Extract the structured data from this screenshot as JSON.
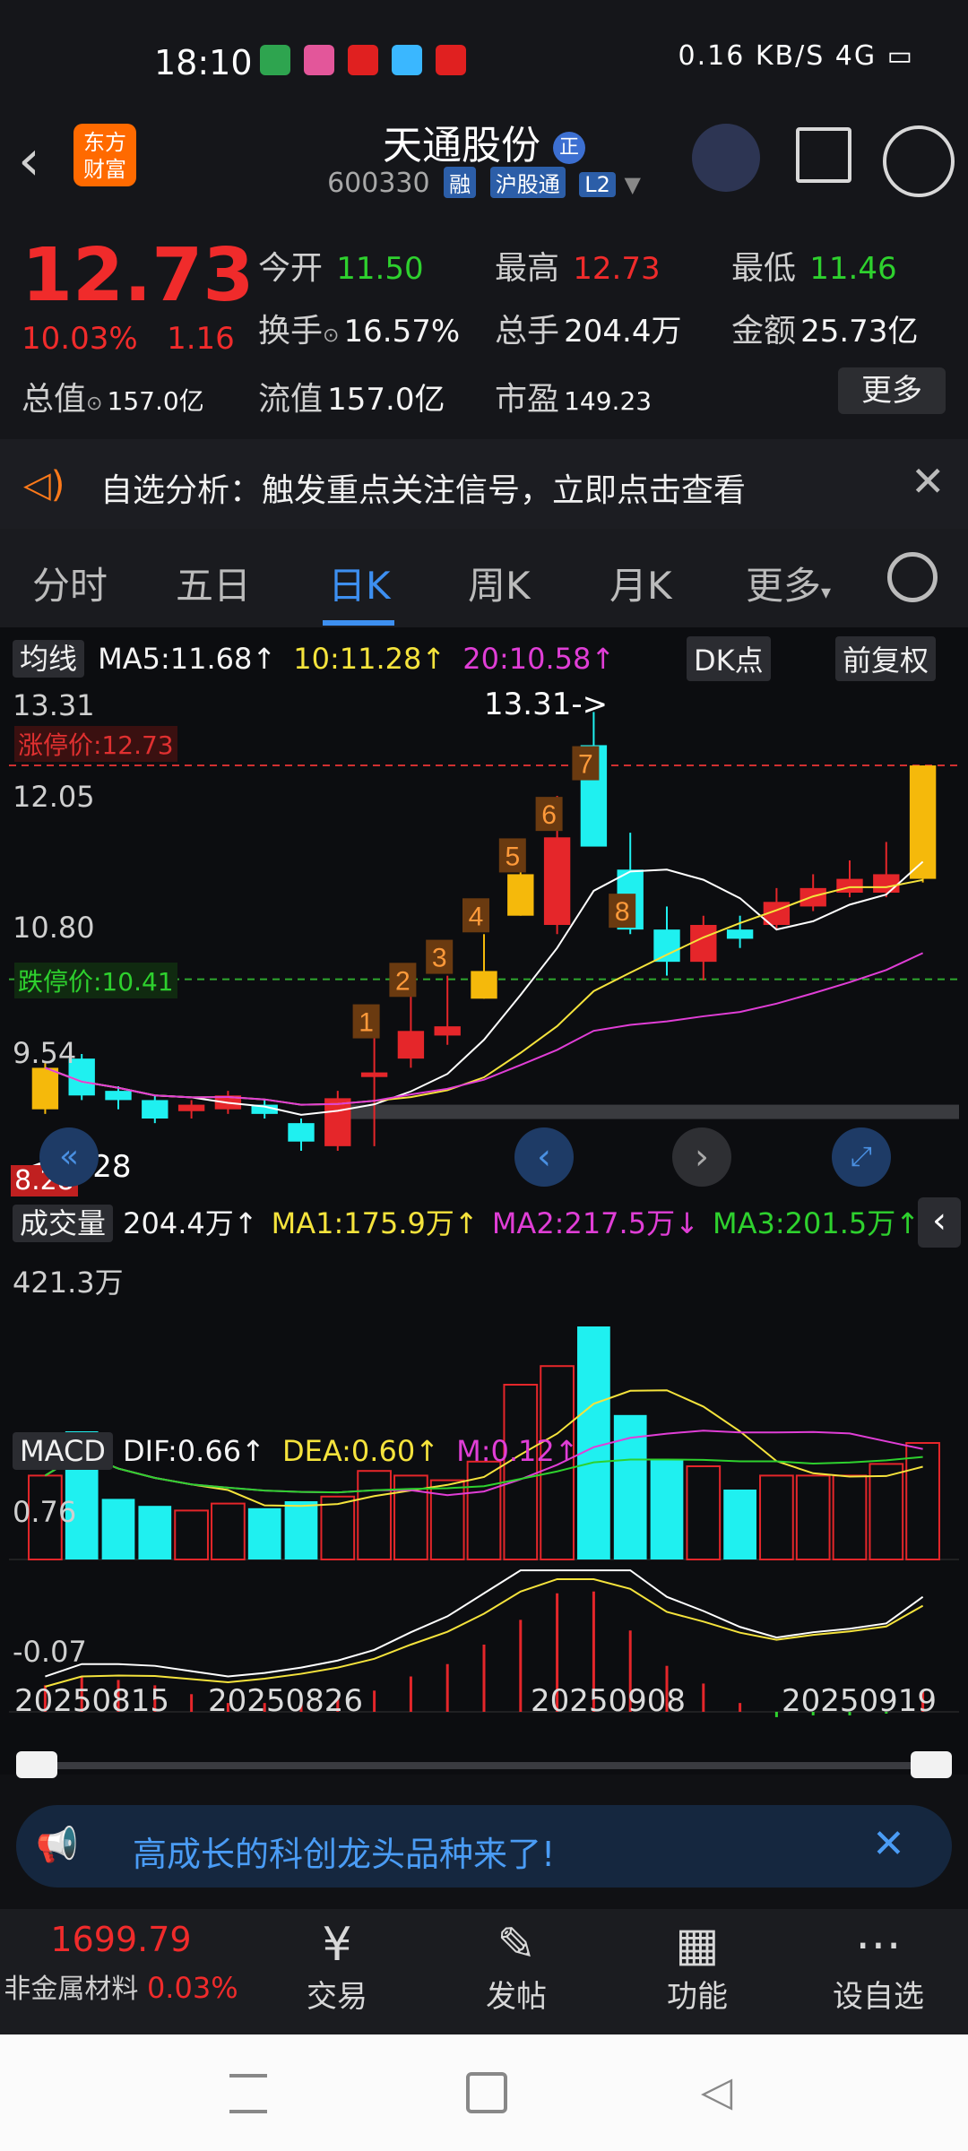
{
  "status": {
    "time": "18:10",
    "right": "0.16 KB/S  4G  ▭"
  },
  "header": {
    "logo": "东方财富",
    "title": "天通股份",
    "badge": "正",
    "code": "600330",
    "tags": [
      "融",
      "沪股通",
      "L2"
    ]
  },
  "quote": {
    "price": "12.73",
    "pct": "10.03%",
    "change": "1.16",
    "row1": [
      {
        "label": "今开",
        "value": "11.50",
        "color": "green"
      },
      {
        "label": "最高",
        "value": "12.73",
        "color": "red"
      },
      {
        "label": "最低",
        "value": "11.46",
        "color": "green"
      }
    ],
    "row2": [
      {
        "label": "换手",
        "value": "16.57%"
      },
      {
        "label": "总手",
        "value": "204.4万"
      },
      {
        "label": "金额",
        "value": "25.73亿"
      }
    ],
    "row3": [
      {
        "label": "总值",
        "value": "157.0亿"
      },
      {
        "label": "流值",
        "value": "157.0亿"
      },
      {
        "label": "市盈",
        "value": "149.23"
      }
    ],
    "more": "更多"
  },
  "notice": {
    "text": "自选分析：触发重点关注信号，立即点击查看"
  },
  "tabs": [
    "分时",
    "五日",
    "日K",
    "周K",
    "月K",
    "更多"
  ],
  "active_tab": 2,
  "kline": {
    "indicator": "均线",
    "ma5": "MA5:11.68",
    "ma10": "10:11.28",
    "ma20": "20:10.58",
    "dk": "DK点",
    "adjust": "前复权",
    "ymax_label": "13.31",
    "y2_label": "12.05",
    "y3_label": "10.80",
    "y4_label": "9.54",
    "limit_up": "涨停价:12.73",
    "limit_down": "跌停价:10.41",
    "high_mark": "13.31->",
    "low_mark": "<-8.28",
    "low_label": "8.28"
  },
  "volume": {
    "indicator": "成交量",
    "val": "204.4万",
    "ma1": "MA1:175.9万",
    "ma2": "MA2:217.5万",
    "ma3": "MA3:201.5万",
    "ymax": "421.3万"
  },
  "macd": {
    "indicator": "MACD",
    "dif": "DIF:0.66",
    "dea": "DEA:0.60",
    "m": "M:0.12",
    "ymax": "0.76",
    "ymin": "-0.07"
  },
  "dates": [
    "20250815",
    "20250826",
    "20250908",
    "20250919"
  ],
  "ad": {
    "text": "高成长的科创龙头品种来了!"
  },
  "footer": {
    "index_value": "1699.79",
    "index_name": "非金属材料",
    "index_pct": "0.03%",
    "items": [
      "交易",
      "发帖",
      "功能",
      "设自选"
    ]
  },
  "chart_data": {
    "type": "candlestick",
    "candles": [
      {
        "o": 9.0,
        "c": 9.45,
        "h": 9.5,
        "l": 8.95,
        "up": true
      },
      {
        "o": 9.55,
        "c": 9.15,
        "h": 9.6,
        "l": 9.1,
        "up": false
      },
      {
        "o": 9.2,
        "c": 9.1,
        "h": 9.25,
        "l": 9.0,
        "up": false
      },
      {
        "o": 9.1,
        "c": 8.9,
        "h": 9.15,
        "l": 8.85,
        "up": false
      },
      {
        "o": 8.98,
        "c": 9.05,
        "h": 9.1,
        "l": 8.9,
        "up": true
      },
      {
        "o": 9.0,
        "c": 9.15,
        "h": 9.2,
        "l": 8.95,
        "up": true
      },
      {
        "o": 9.05,
        "c": 8.95,
        "h": 9.1,
        "l": 8.9,
        "up": false
      },
      {
        "o": 8.85,
        "c": 8.65,
        "h": 8.9,
        "l": 8.55,
        "up": false
      },
      {
        "o": 8.6,
        "c": 9.12,
        "h": 9.2,
        "l": 8.55,
        "up": true
      },
      {
        "o": 9.35,
        "c": 9.4,
        "h": 9.8,
        "l": 8.6,
        "up": true
      },
      {
        "o": 9.55,
        "c": 9.85,
        "h": 10.25,
        "l": 9.45,
        "up": true
      },
      {
        "o": 9.8,
        "c": 9.9,
        "h": 10.45,
        "l": 9.7,
        "up": true
      },
      {
        "o": 10.2,
        "c": 10.5,
        "h": 10.9,
        "l": 10.2,
        "up": true
      },
      {
        "o": 11.1,
        "c": 11.55,
        "h": 11.6,
        "l": 11.1,
        "up": true
      },
      {
        "o": 11.0,
        "c": 11.95,
        "h": 12.4,
        "l": 10.9,
        "up": true
      },
      {
        "o": 11.85,
        "c": 12.95,
        "h": 13.31,
        "l": 11.9,
        "up": false
      },
      {
        "o": 11.6,
        "c": 10.95,
        "h": 12.0,
        "l": 10.9,
        "up": false
      },
      {
        "o": 10.95,
        "c": 10.6,
        "h": 11.2,
        "l": 10.45,
        "up": false
      },
      {
        "o": 10.6,
        "c": 11.0,
        "h": 11.1,
        "l": 10.4,
        "up": true
      },
      {
        "o": 10.85,
        "c": 10.95,
        "h": 11.1,
        "l": 10.75,
        "up": false
      },
      {
        "o": 11.0,
        "c": 11.25,
        "h": 11.4,
        "l": 10.95,
        "up": true
      },
      {
        "o": 11.2,
        "c": 11.4,
        "h": 11.55,
        "l": 11.15,
        "up": true
      },
      {
        "o": 11.35,
        "c": 11.5,
        "h": 11.7,
        "l": 11.3,
        "up": true
      },
      {
        "o": 11.35,
        "c": 11.55,
        "h": 11.9,
        "l": 11.3,
        "up": true
      },
      {
        "o": 11.5,
        "c": 12.73,
        "h": 12.73,
        "l": 11.46,
        "up": true
      }
    ],
    "volume_bars": [
      0.36,
      0.55,
      0.26,
      0.23,
      0.21,
      0.24,
      0.22,
      0.25,
      0.27,
      0.38,
      0.36,
      0.34,
      0.42,
      0.75,
      0.83,
      1.0,
      0.62,
      0.43,
      0.4,
      0.3,
      0.36,
      0.36,
      0.36,
      0.41,
      0.5
    ],
    "macd_bars": [
      0.15,
      0.2,
      0.18,
      0.15,
      0.1,
      0.05,
      0.05,
      0.06,
      0.08,
      0.12,
      0.2,
      0.27,
      0.38,
      0.52,
      0.67,
      0.68,
      0.46,
      0.26,
      0.16,
      0.05,
      -0.03,
      -0.02,
      -0.02,
      -0.01,
      0.12
    ]
  }
}
